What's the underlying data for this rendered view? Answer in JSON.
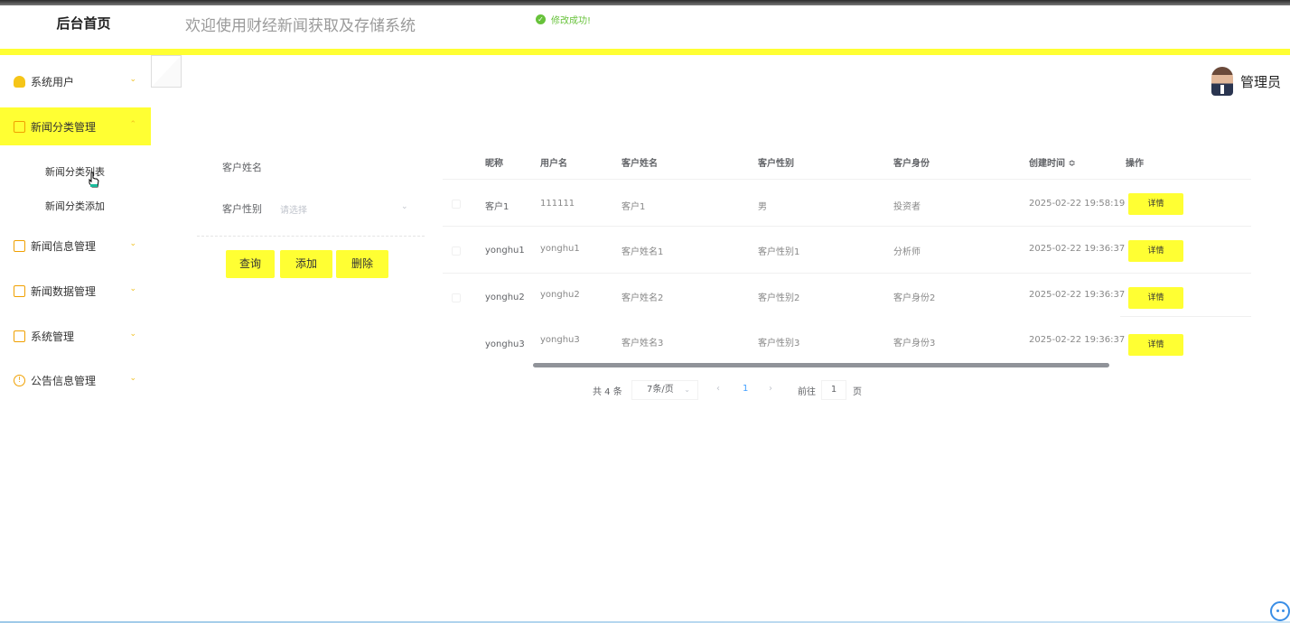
{
  "header": {
    "brand": "后台首页",
    "system_title": "欢迎使用财经新闻获取及存储系统",
    "toast": "修改成功!"
  },
  "user": {
    "name": "管理员"
  },
  "sidebar": {
    "items": [
      {
        "label": "系统用户",
        "icon": "user-icon"
      },
      {
        "label": "新闻分类管理",
        "icon": "box-icon",
        "active": true,
        "children": [
          "新闻分类列表",
          "新闻分类添加"
        ]
      },
      {
        "label": "新闻信息管理",
        "icon": "box-icon"
      },
      {
        "label": "新闻数据管理",
        "icon": "box-icon"
      },
      {
        "label": "系统管理",
        "icon": "image-icon"
      },
      {
        "label": "公告信息管理",
        "icon": "info-icon"
      }
    ]
  },
  "search": {
    "name_label": "客户姓名",
    "gender_label": "客户性别",
    "gender_placeholder": "请选择",
    "query_button": "查询",
    "add_button": "添加",
    "delete_button": "删除"
  },
  "table": {
    "columns": [
      "昵称",
      "用户名",
      "客户姓名",
      "客户性别",
      "客户身份",
      "创建时间 ≎",
      "操作"
    ],
    "detail_label": "详情",
    "rows": [
      [
        "客户1",
        "111111",
        "客户1",
        "男",
        "投资者",
        "2025-02-22 19:58:19"
      ],
      [
        "yonghu1",
        "yonghu1",
        "客户姓名1",
        "客户性别1",
        "分析师",
        "2025-02-22 19:36:37"
      ],
      [
        "yonghu2",
        "yonghu2",
        "客户姓名2",
        "客户性别2",
        "客户身份2",
        "2025-02-22 19:36:37"
      ],
      [
        "yonghu3",
        "yonghu3",
        "客户姓名3",
        "客户性别3",
        "客户身份3",
        "2025-02-22 19:36:37"
      ]
    ]
  },
  "pagination": {
    "total": "共 4 条",
    "page_size": "7条/页",
    "prev": "‹",
    "current": "1",
    "next": "›",
    "goto_label": "前往",
    "goto_value": "1",
    "page_unit": "页"
  },
  "colors": {
    "accent": "#ffff33",
    "success": "#67c23a",
    "link": "#409eff"
  }
}
